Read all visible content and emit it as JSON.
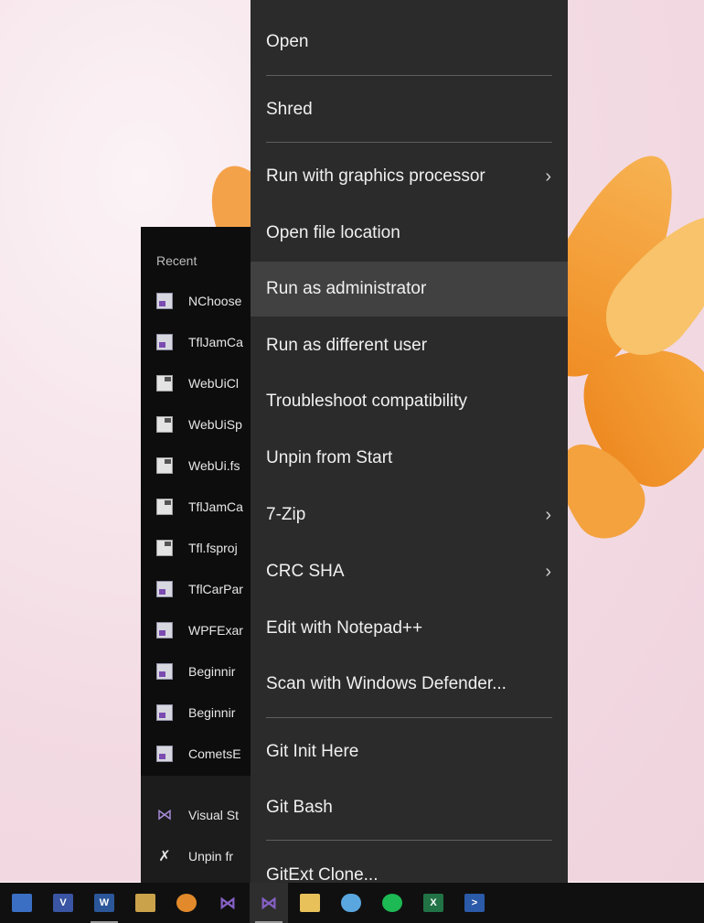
{
  "jump_list": {
    "header": "Recent",
    "recent_items": [
      {
        "label": "NChoose",
        "icon": "visual-studio-project-icon"
      },
      {
        "label": "TflJamCa",
        "icon": "visual-studio-project-icon"
      },
      {
        "label": "WebUiCl",
        "icon": "fsharp-file-icon"
      },
      {
        "label": "WebUiSp",
        "icon": "fsharp-file-icon"
      },
      {
        "label": "WebUi.fs",
        "icon": "fsharp-file-icon"
      },
      {
        "label": "TflJamCa",
        "icon": "fsharp-file-icon"
      },
      {
        "label": "Tfl.fsproj",
        "icon": "fsharp-file-icon"
      },
      {
        "label": "TflCarPar",
        "icon": "visual-studio-project-icon"
      },
      {
        "label": "WPFExar",
        "icon": "visual-studio-project-icon"
      },
      {
        "label": "Beginnir",
        "icon": "visual-studio-project-icon"
      },
      {
        "label": "Beginnir",
        "icon": "visual-studio-project-icon"
      },
      {
        "label": "CometsE",
        "icon": "visual-studio-project-icon"
      }
    ],
    "app_label": "Visual St",
    "unpin_label": "Unpin fr"
  },
  "context_menu": {
    "items": [
      {
        "label": "Open",
        "has_submenu": false
      },
      {
        "label": "Shred",
        "has_submenu": false
      },
      {
        "label": "Run with graphics processor",
        "has_submenu": true
      },
      {
        "label": "Open file location",
        "has_submenu": false
      },
      {
        "label": "Run as administrator",
        "has_submenu": false,
        "highlighted": true
      },
      {
        "label": "Run as different user",
        "has_submenu": false
      },
      {
        "label": "Troubleshoot compatibility",
        "has_submenu": false
      },
      {
        "label": "Unpin from Start",
        "has_submenu": false
      },
      {
        "label": "7-Zip",
        "has_submenu": true
      },
      {
        "label": "CRC SHA",
        "has_submenu": true
      },
      {
        "label": "Edit with Notepad++",
        "has_submenu": false
      },
      {
        "label": "Scan with Windows Defender...",
        "has_submenu": false
      },
      {
        "label": "Git Init Here",
        "has_submenu": false
      },
      {
        "label": "Git Bash",
        "has_submenu": false
      },
      {
        "label": "GitExt Clone...",
        "has_submenu": false
      }
    ],
    "chevron": "›"
  },
  "taskbar": {
    "icons": [
      {
        "name": "app-icon-1",
        "glyph": "",
        "color": "#3a6fc4"
      },
      {
        "name": "visio-icon",
        "glyph": "V",
        "color": "#3955a3"
      },
      {
        "name": "word-icon",
        "glyph": "W",
        "color": "#2b579a"
      },
      {
        "name": "tools-icon",
        "glyph": "",
        "color": "#c9a24a"
      },
      {
        "name": "paint-icon",
        "glyph": "",
        "color": "#e28a2b"
      },
      {
        "name": "visual-studio-icon",
        "glyph": "",
        "color": "#8661c5"
      },
      {
        "name": "visual-studio-active-icon",
        "glyph": "",
        "color": "#8661c5",
        "active": true
      },
      {
        "name": "folder-icon",
        "glyph": "",
        "color": "#e8c15a"
      },
      {
        "name": "cloud-icon",
        "glyph": "",
        "color": "#5aa7e0"
      },
      {
        "name": "spotify-icon",
        "glyph": "",
        "color": "#1db954"
      },
      {
        "name": "excel-icon",
        "glyph": "X",
        "color": "#217346"
      },
      {
        "name": "powershell-icon",
        "glyph": ">",
        "color": "#2a5aa8"
      }
    ]
  },
  "colors": {
    "menu_bg": "#2b2b2b",
    "menu_hover": "#414141",
    "jumplist_bg": "#0d0d0d",
    "taskbar_bg": "#101010"
  }
}
